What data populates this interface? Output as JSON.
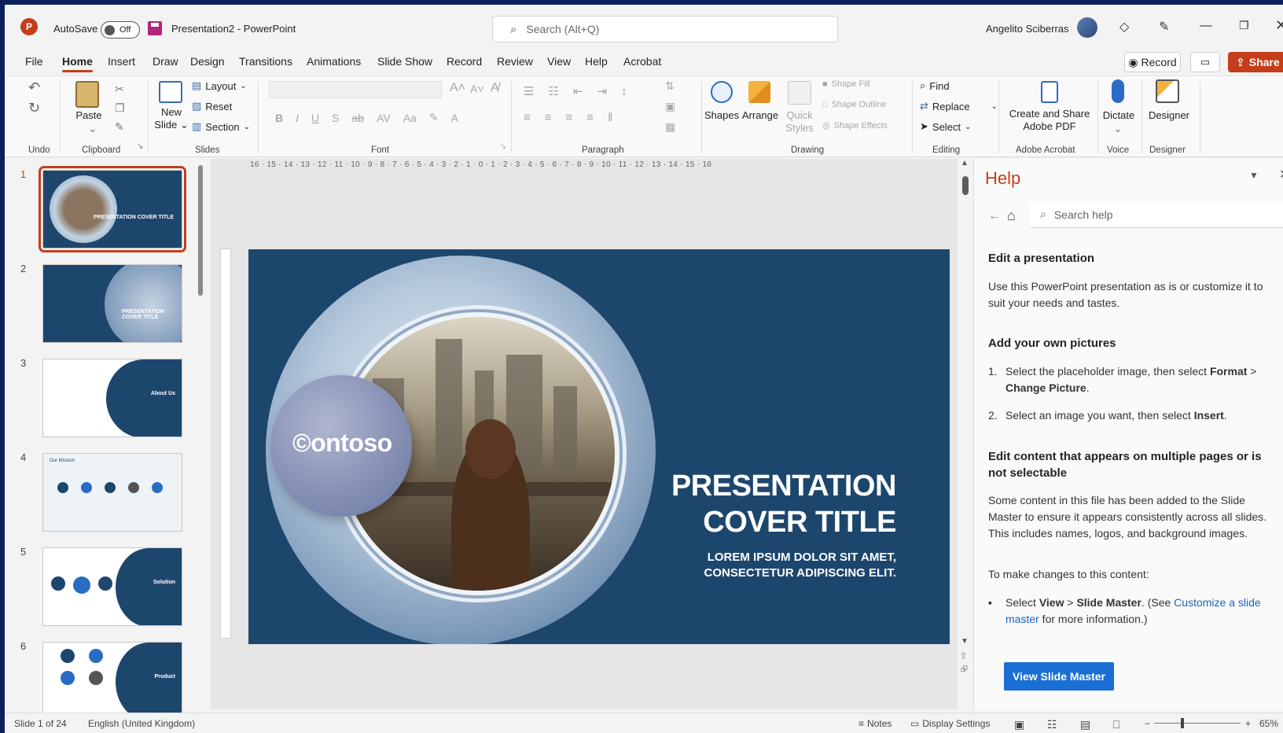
{
  "titlebar": {
    "app_icon": "P",
    "autosave_label": "AutoSave",
    "autosave_state": "Off",
    "doc_title": "Presentation2 - PowerPoint",
    "search_placeholder": "Search (Alt+Q)",
    "user_name": "Angelito Sciberras"
  },
  "menu": {
    "tabs": [
      "File",
      "Home",
      "Insert",
      "Draw",
      "Design",
      "Transitions",
      "Animations",
      "Slide Show",
      "Record",
      "Review",
      "View",
      "Help",
      "Acrobat"
    ],
    "record_label": "Record",
    "share_label": "Share"
  },
  "ribbon": {
    "groups": {
      "undo": "Undo",
      "clipboard": "Clipboard",
      "slides": "Slides",
      "font": "Font",
      "paragraph": "Paragraph",
      "drawing": "Drawing",
      "editing": "Editing",
      "adobe": "Adobe Acrobat",
      "voice": "Voice",
      "designer": "Designer"
    },
    "paste": "Paste",
    "new_slide": [
      "New",
      "Slide"
    ],
    "layout": "Layout",
    "reset": "Reset",
    "section": "Section",
    "shapes": "Shapes",
    "arrange": "Arrange",
    "quick_styles": [
      "Quick",
      "Styles"
    ],
    "shape_fill": "Shape Fill",
    "shape_outline": "Shape Outline",
    "shape_effects": "Shape Effects",
    "find": "Find",
    "replace": "Replace",
    "select": "Select",
    "create_share": [
      "Create and Share",
      "Adobe PDF"
    ],
    "dictate": "Dictate",
    "designer_btn": "Designer"
  },
  "slides": {
    "numbers": [
      "1",
      "2",
      "3",
      "4",
      "5",
      "6"
    ],
    "thumb_titles": [
      "PRESENTATION COVER TITLE",
      "PRESENTATION COVER TITLE",
      "About Us",
      "Our Mission",
      "Solution",
      "Product"
    ]
  },
  "ruler": {
    "horizontal": "16 · 15 · 14 · 13 · 12 · 11 · 10 · 9 · 8 · 7 · 6 · 5 · 4 · 3 · 2 · 1 · 0 · 1 · 2 · 3 · 4 · 5 · 6 · 7 · 8 · 9 · 10 · 11 · 12 · 13 · 14 · 15 · 16"
  },
  "slide": {
    "logo": "©ontoso",
    "title_line1": "PRESENTATION",
    "title_line2": "COVER TITLE",
    "subtitle_line1": "LOREM IPSUM DOLOR SIT AMET,",
    "subtitle_line2": "CONSECTETUR ADIPISCING ELIT."
  },
  "help": {
    "title": "Help",
    "search_placeholder": "Search help",
    "h1": "Edit a presentation",
    "p1": "Use this PowerPoint presentation as is or customize it to suit your needs and tastes.",
    "h2": "Add your own pictures",
    "li1_num": "1.",
    "li1_a": "Select the placeholder image, then select ",
    "li1_b": "Format",
    "li1_c": " > ",
    "li1_d": "Change Picture",
    "li1_e": ".",
    "li2_num": "2.",
    "li2_a": "Select an image you want, then select ",
    "li2_b": "Insert",
    "li2_c": ".",
    "h3": "Edit content that appears on multiple pages or is not selectable",
    "p2": "Some content in this file has been added to the Slide Master to ensure it appears consistently across all slides. This includes names, logos, and background images.",
    "p3": "To make changes to this content:",
    "bullet_a": "Select ",
    "bullet_b": "View",
    "bullet_c": " > ",
    "bullet_d": "Slide Master",
    "bullet_e": ". (See ",
    "bullet_link": "Customize a slide master",
    "bullet_f": " for more information.)",
    "button": "View Slide Master"
  },
  "status": {
    "slide_count": "Slide 1 of 24",
    "language": "English (United Kingdom)",
    "notes": "Notes",
    "display_settings": "Display Settings",
    "zoom": "65%"
  }
}
